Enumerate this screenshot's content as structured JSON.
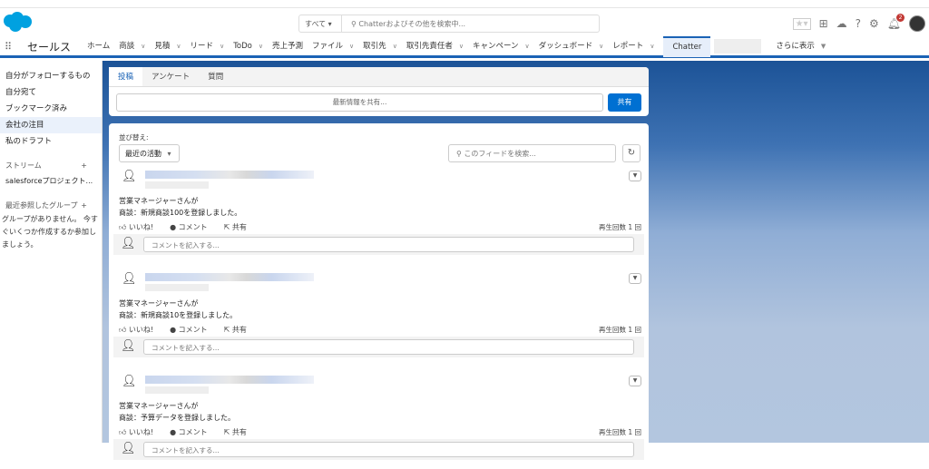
{
  "header": {
    "search_scope": "すべて",
    "search_placeholder": "Chatterおよびその他を検索中...",
    "notification_count": "2"
  },
  "nav": {
    "app_name": "セールス",
    "items": [
      {
        "label": "ホーム",
        "chevron": false
      },
      {
        "label": "商談",
        "chevron": true
      },
      {
        "label": "見積",
        "chevron": true
      },
      {
        "label": "リード",
        "chevron": true
      },
      {
        "label": "ToDo",
        "chevron": true
      },
      {
        "label": "売上予測",
        "chevron": false
      },
      {
        "label": "ファイル",
        "chevron": true
      },
      {
        "label": "取引先",
        "chevron": true
      },
      {
        "label": "取引先責任者",
        "chevron": true
      },
      {
        "label": "キャンペーン",
        "chevron": true
      },
      {
        "label": "ダッシュボード",
        "chevron": true
      },
      {
        "label": "レポート",
        "chevron": true
      }
    ],
    "active": "Chatter",
    "more": "さらに表示"
  },
  "sidebar": {
    "items": [
      "自分がフォローするもの",
      "自分宛て",
      "ブックマーク済み",
      "会社の注目",
      "私のドラフト"
    ],
    "stream_header": "ストリーム",
    "stream_item": "salesforceプロジェクト...",
    "groups_header": "最近参照したグループ",
    "groups_empty": "グループがありません。 今すぐいくつか作成するか参加しましょう。"
  },
  "composer": {
    "tabs": [
      "投稿",
      "アンケート",
      "質問"
    ],
    "placeholder": "最新情報を共有...",
    "share": "共有"
  },
  "feed": {
    "sort_label": "並び替え:",
    "sort_value": "最近の活動",
    "search_placeholder": "このフィードを検索...",
    "posts": [
      {
        "line1": "営業マネージャーさんが",
        "line2": "商談：新規商談100を登録しました。",
        "views": "再生回数 1 回"
      },
      {
        "line1": "営業マネージャーさんが",
        "line2": "商談：新規商談10を登録しました。",
        "views": "再生回数 1 回"
      },
      {
        "line1": "営業マネージャーさんが",
        "line2": "商談：予算データを登録しました。",
        "views": "再生回数 1 回"
      }
    ],
    "like": "いいね!",
    "comment": "コメント",
    "share": "共有",
    "comment_placeholder": "コメントを記入する..."
  }
}
